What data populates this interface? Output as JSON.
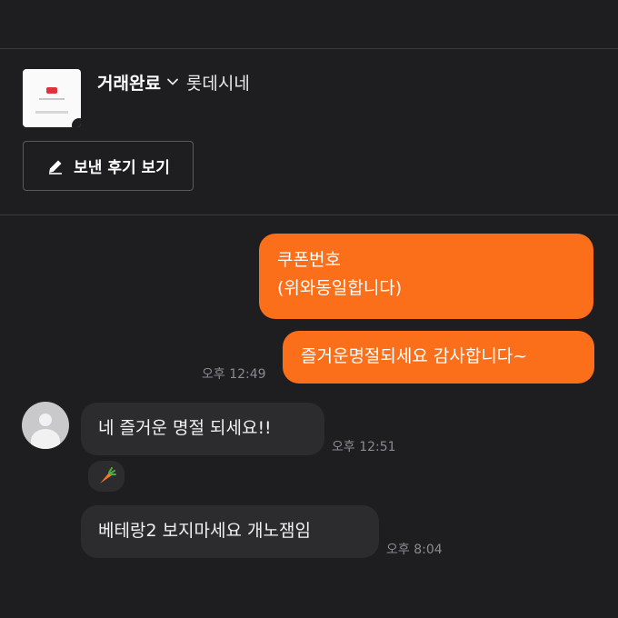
{
  "transaction": {
    "status": "거래완료",
    "product_name": "롯데시네",
    "review_button_label": "보낸 후기 보기"
  },
  "messages": [
    {
      "sender": "me",
      "lines": [
        "쿠폰번호",
        "(위와동일합니다)"
      ]
    },
    {
      "sender": "me",
      "text": "즐거운명절되세요 감사합니다~",
      "time": "오후 12:49"
    },
    {
      "sender": "other",
      "text": "네 즐거운 명절 되세요!!",
      "time": "오후 12:51"
    },
    {
      "sender": "other",
      "reaction_icon": "carrot-icon"
    },
    {
      "sender": "other",
      "text": "베테랑2 보지마세요 개노잼임",
      "time": "오후 8:04"
    }
  ],
  "colors": {
    "background": "#1e1e20",
    "my_bubble": "#fb6f1a",
    "their_bubble": "#2c2c2f",
    "timestamp": "#8b8b8f"
  }
}
